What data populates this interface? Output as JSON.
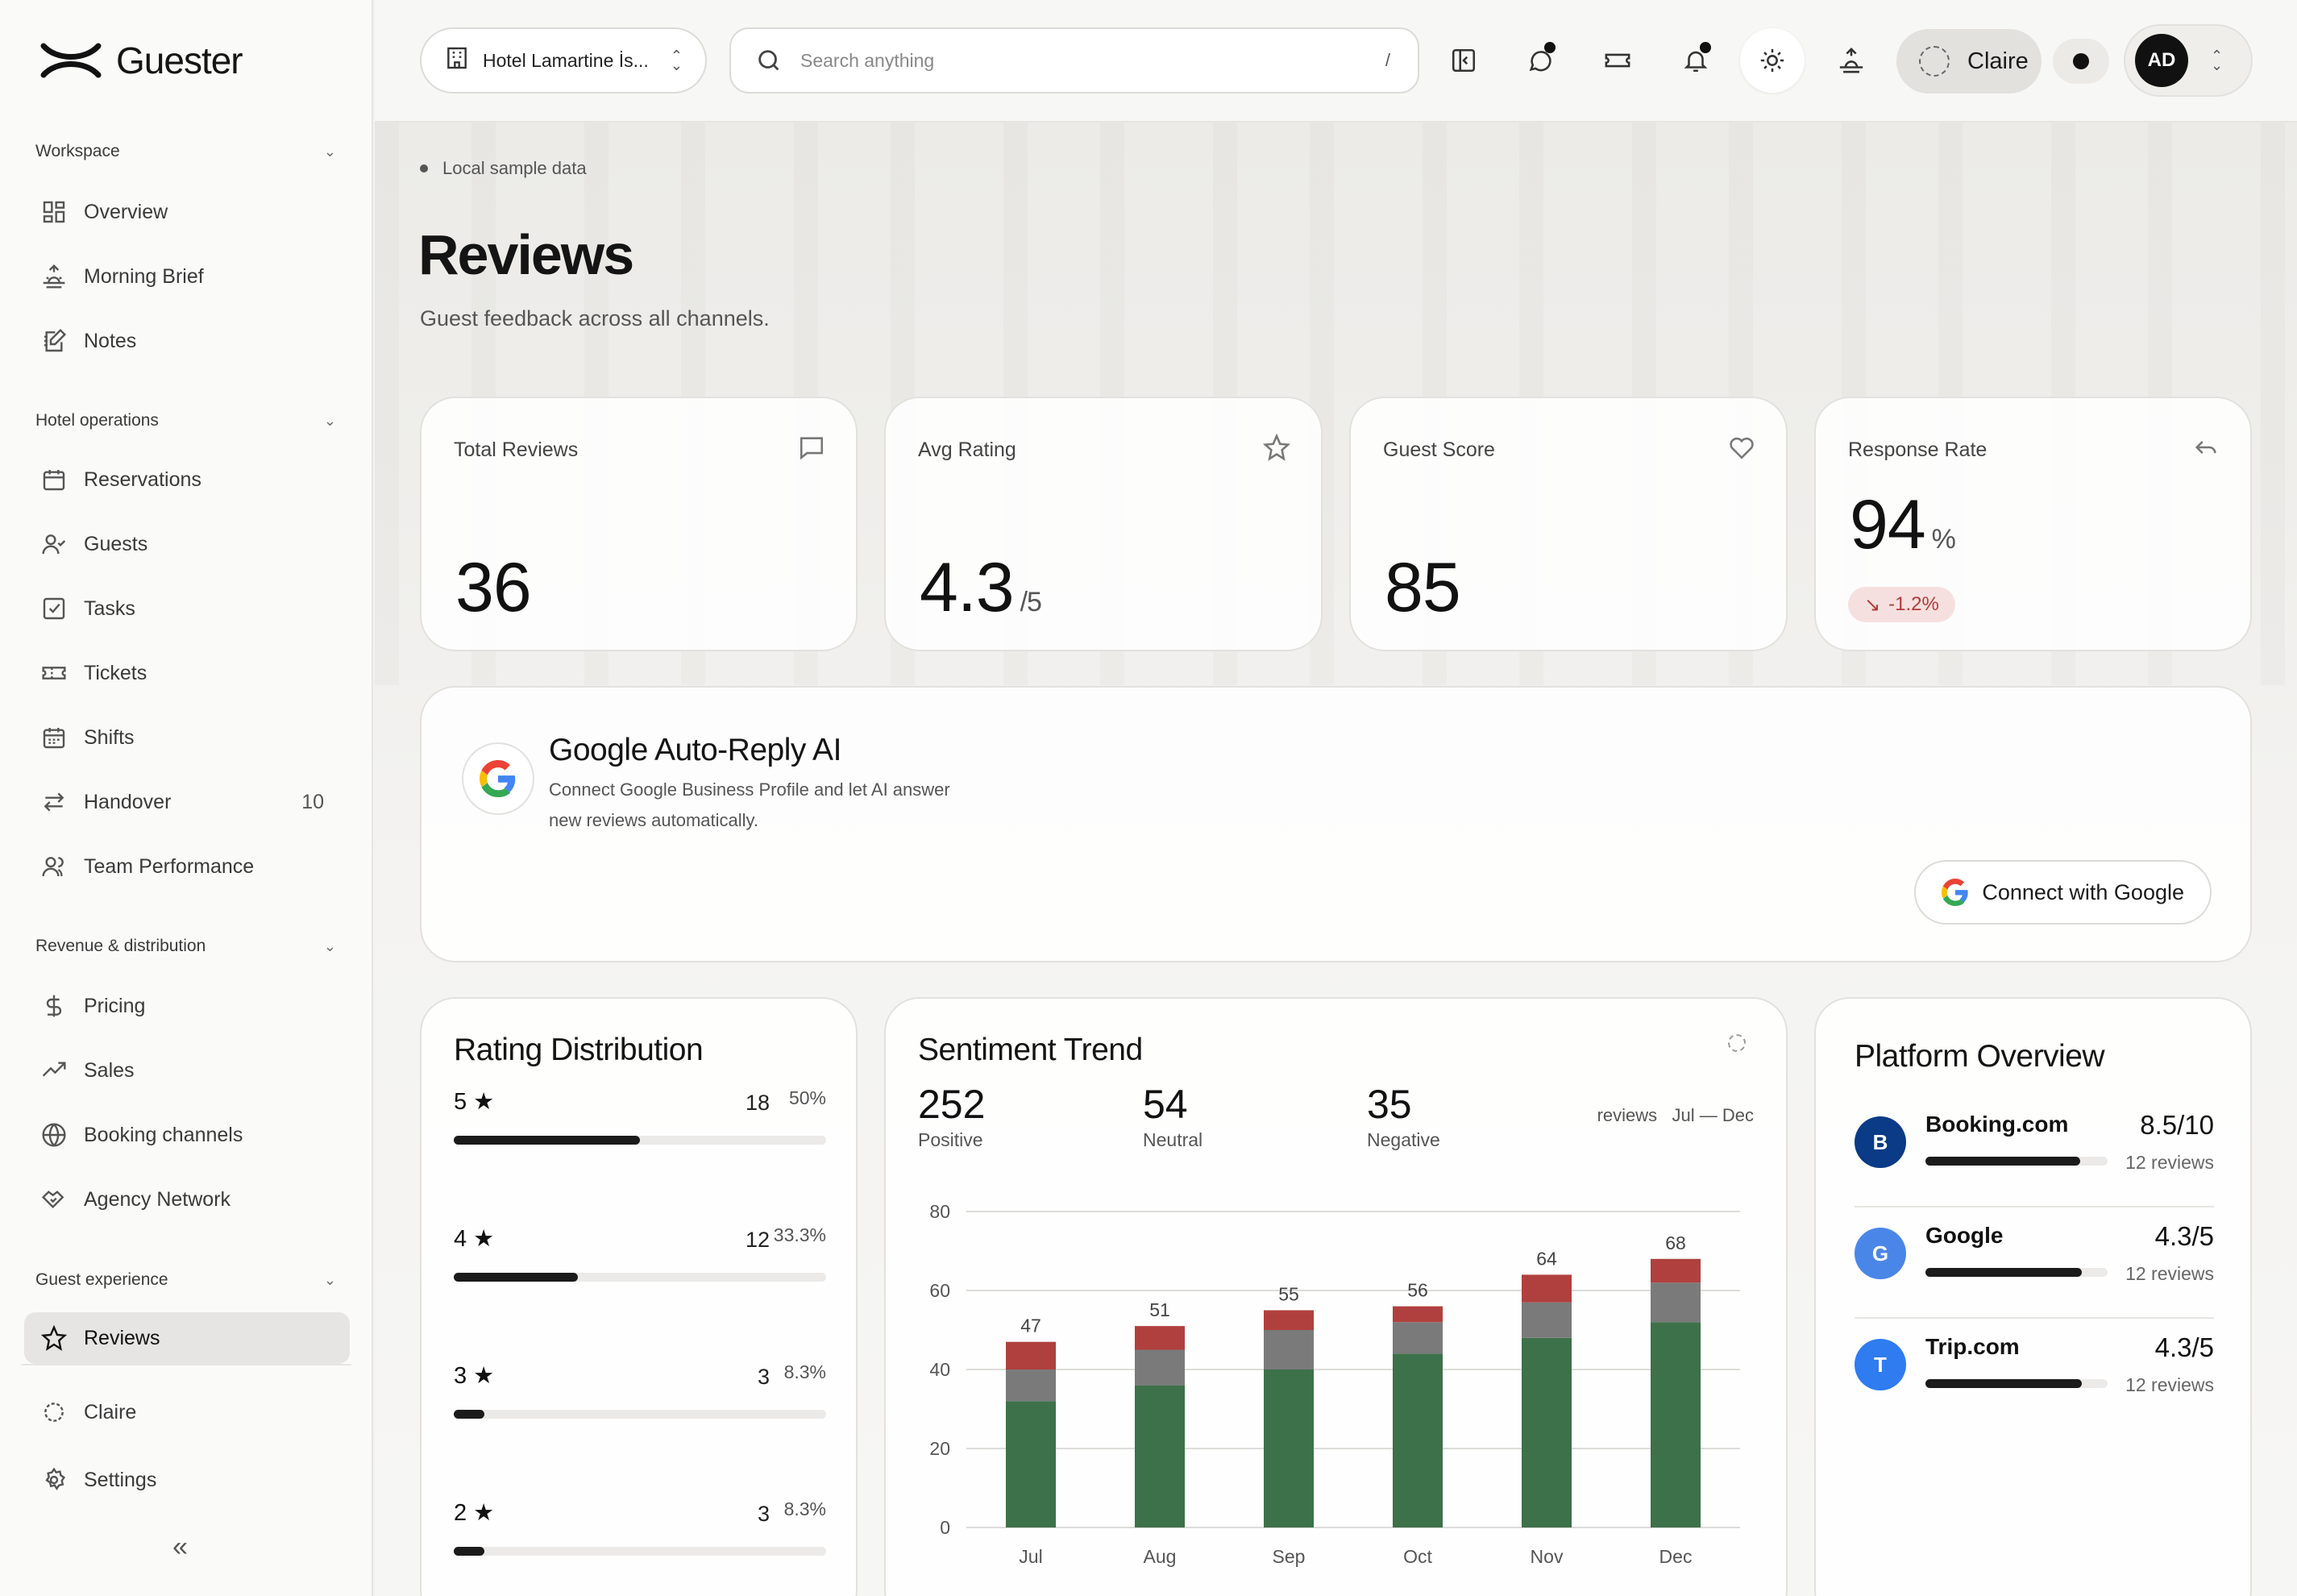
{
  "brand": {
    "name": "Guester"
  },
  "sidebar": {
    "sections": [
      {
        "title": "Workspace",
        "items": [
          {
            "label": "Overview",
            "icon": "grid-icon"
          },
          {
            "label": "Morning Brief",
            "icon": "sunrise-icon"
          },
          {
            "label": "Notes",
            "icon": "notes-icon"
          }
        ]
      },
      {
        "title": "Hotel operations",
        "items": [
          {
            "label": "Reservations",
            "icon": "calendar-icon"
          },
          {
            "label": "Guests",
            "icon": "user-check-icon"
          },
          {
            "label": "Tasks",
            "icon": "checkbox-icon"
          },
          {
            "label": "Tickets",
            "icon": "ticket-icon"
          },
          {
            "label": "Shifts",
            "icon": "calendar-grid-icon"
          },
          {
            "label": "Handover",
            "icon": "arrows-swap-icon",
            "count": "10"
          },
          {
            "label": "Team Performance",
            "icon": "users-icon"
          }
        ]
      },
      {
        "title": "Revenue & distribution",
        "items": [
          {
            "label": "Pricing",
            "icon": "dollar-icon"
          },
          {
            "label": "Sales",
            "icon": "trend-up-icon"
          },
          {
            "label": "Booking channels",
            "icon": "globe-icon"
          },
          {
            "label": "Agency Network",
            "icon": "handshake-icon"
          }
        ]
      },
      {
        "title": "Guest experience",
        "items": [
          {
            "label": "Reviews",
            "icon": "star-icon",
            "active": true
          }
        ]
      }
    ],
    "footer": [
      {
        "label": "Claire",
        "icon": "claire-blob-icon"
      },
      {
        "label": "Settings",
        "icon": "gear-icon"
      }
    ],
    "collapse_glyph": "«"
  },
  "topbar": {
    "hotel": "Hotel Lamartine İs...",
    "search_placeholder": "Search anything",
    "search_shortcut": "/",
    "assistant_label": "Claire",
    "avatar_initials": "AD"
  },
  "page": {
    "tag": "Local sample data",
    "title": "Reviews",
    "subtitle": "Guest feedback across all channels."
  },
  "kpis": {
    "total_reviews": {
      "label": "Total Reviews",
      "value": "36"
    },
    "avg_rating": {
      "label": "Avg Rating",
      "value": "4.3",
      "suffix": "/5"
    },
    "guest_score": {
      "label": "Guest Score",
      "value": "85"
    },
    "response_rate": {
      "label": "Response Rate",
      "value": "94",
      "suffix": "%",
      "delta": "-1.2%"
    }
  },
  "google_card": {
    "title": "Google Auto-Reply AI",
    "description": "Connect Google Business Profile and let AI answer new reviews automatically.",
    "button": "Connect with Google"
  },
  "rating_distribution": {
    "title": "Rating Distribution",
    "rows": [
      {
        "label": "5 ★",
        "count": "18",
        "pct": "50%",
        "fraction": 0.5
      },
      {
        "label": "4 ★",
        "count": "12",
        "pct": "33.3%",
        "fraction": 0.333
      },
      {
        "label": "3 ★",
        "count": "3",
        "pct": "8.3%",
        "fraction": 0.083
      },
      {
        "label": "2 ★",
        "count": "3",
        "pct": "8.3%",
        "fraction": 0.083
      }
    ]
  },
  "sentiment": {
    "title": "Sentiment Trend",
    "stats": [
      {
        "value": "252",
        "label": "Positive"
      },
      {
        "value": "54",
        "label": "Neutral"
      },
      {
        "value": "35",
        "label": "Negative"
      }
    ],
    "range": "reviews   Jul — Dec"
  },
  "chart_data": {
    "type": "bar",
    "stacked": true,
    "categories": [
      "Jul",
      "Aug",
      "Sep",
      "Oct",
      "Nov",
      "Dec"
    ],
    "series": [
      {
        "name": "Positive",
        "color": "#3d714a",
        "values": [
          32,
          36,
          40,
          44,
          48,
          52
        ]
      },
      {
        "name": "Neutral",
        "color": "#7a7a7a",
        "values": [
          8,
          9,
          10,
          8,
          9,
          10
        ]
      },
      {
        "name": "Negative",
        "color": "#b0403e",
        "values": [
          7,
          6,
          5,
          4,
          7,
          6
        ]
      }
    ],
    "totals": [
      47,
      51,
      55,
      56,
      64,
      68
    ],
    "ylim": [
      0,
      80
    ],
    "yticks": [
      0,
      20,
      40,
      60,
      80
    ],
    "grid": true
  },
  "platforms": {
    "title": "Platform Overview",
    "rows": [
      {
        "badge": "B",
        "name": "Booking.com",
        "score": "8.5/10",
        "reviews": "12 reviews",
        "fraction": 0.85,
        "color": "#0b3a86"
      },
      {
        "badge": "G",
        "name": "Google",
        "score": "4.3/5",
        "reviews": "12 reviews",
        "fraction": 0.86,
        "color": "#4a86e8"
      },
      {
        "badge": "T",
        "name": "Trip.com",
        "score": "4.3/5",
        "reviews": "12 reviews",
        "fraction": 0.86,
        "color": "#2f7bf0"
      }
    ]
  }
}
